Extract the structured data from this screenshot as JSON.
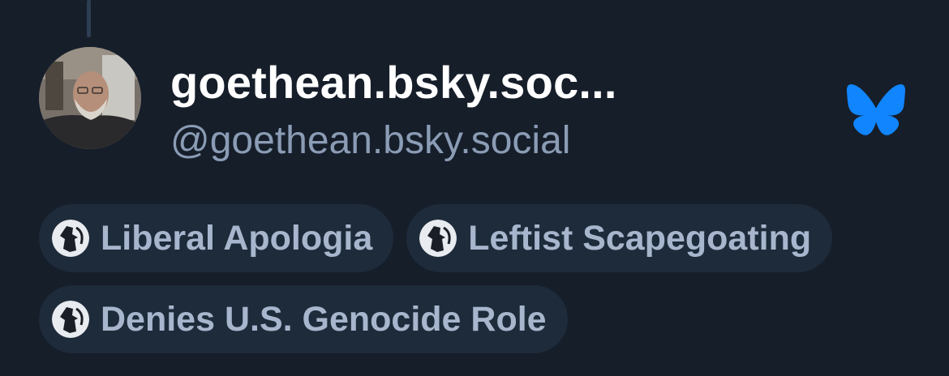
{
  "profile": {
    "display_name": "goethean.bsky.soc...",
    "handle": "@goethean.bsky.social",
    "avatar_icon": "user-avatar-photo"
  },
  "service_icon": "bluesky-butterfly-icon",
  "colors": {
    "background": "#161e2a",
    "accent": "#1185fe",
    "pill_background": "#1e2b3b",
    "pill_text": "#a7b6cc",
    "handle_text": "#8b9cb5"
  },
  "labels": [
    {
      "text": "Liberal Apologia",
      "icon": "labeler-avatar-icon"
    },
    {
      "text": "Leftist Scapegoating",
      "icon": "labeler-avatar-icon"
    },
    {
      "text": "Denies U.S. Genocide Role",
      "icon": "labeler-avatar-icon"
    }
  ]
}
